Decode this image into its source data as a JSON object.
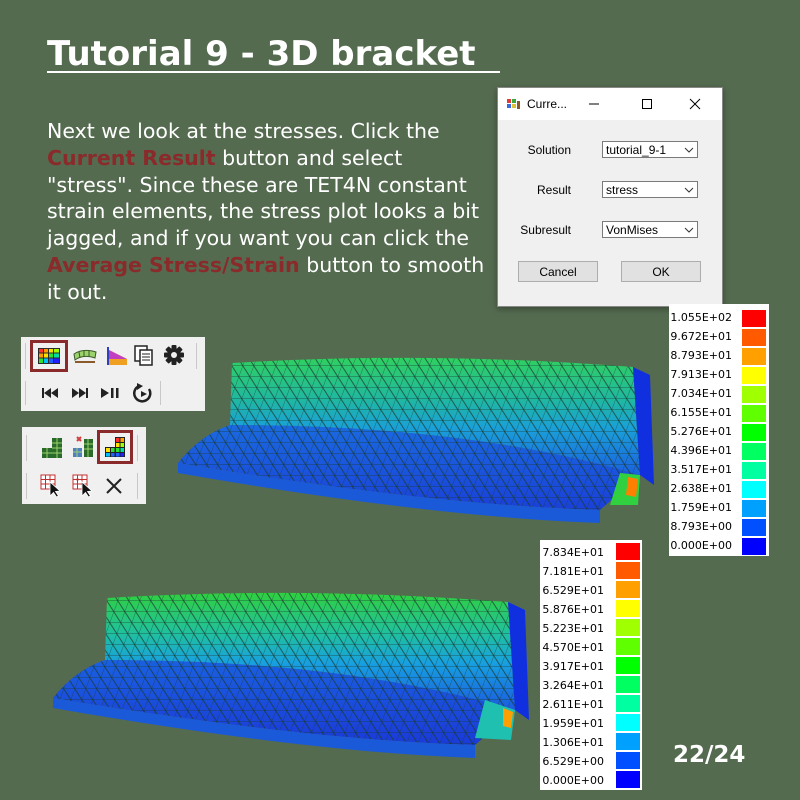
{
  "slide": {
    "title": "Tutorial 9 - 3D bracket ",
    "intro_parts": [
      "Next we look at the stresses. Click the ",
      "Current Result",
      " button and select \"stress\". Since these are TET4N constant strain elements, the stress plot looks a bit jagged, and if you want you can click the ",
      "Average Stress/Strain",
      " button to smooth it out."
    ],
    "page_number": "22/24",
    "highlight_color": "#8a2a2a",
    "background_color": "#556b50"
  },
  "dialog": {
    "title": "Curre...",
    "rows": [
      {
        "label": "Solution",
        "value": "tutorial_9-1"
      },
      {
        "label": "Result",
        "value": "stress"
      },
      {
        "label": "Subresult",
        "value": "VonMises"
      }
    ],
    "cancel_label": "Cancel",
    "ok_label": "OK"
  },
  "toolbar1": {
    "row1_icons": [
      "current-result-icon",
      "deformed-mesh-icon",
      "contour-plot-icon",
      "copy-icon",
      "settings-gear-icon"
    ],
    "row2_icons": [
      "skip-to-start-icon",
      "fast-forward-icon",
      "play-pause-icon",
      "animation-cycle-icon"
    ],
    "highlighted_icon": "current-result-icon"
  },
  "toolbar2": {
    "row1_icons": [
      "mesh-grid-icon",
      "split-mesh-icon",
      "average-stress-strain-icon"
    ],
    "row2_icons": [
      "select-elements-icon",
      "select-nodes-icon",
      "clear-selection-icon"
    ],
    "highlighted_icon": "average-stress-strain-icon"
  },
  "legend_top": {
    "labels": [
      "1.055E+02",
      "9.672E+01",
      "8.793E+01",
      "7.913E+01",
      "7.034E+01",
      "6.155E+01",
      "5.276E+01",
      "4.396E+01",
      "3.517E+01",
      "2.638E+01",
      "1.759E+01",
      "8.793E+00",
      "0.000E+00"
    ]
  },
  "legend_bottom": {
    "labels": [
      "7.834E+01",
      "7.181E+01",
      "6.529E+01",
      "5.876E+01",
      "5.223E+01",
      "4.570E+01",
      "3.917E+01",
      "3.264E+01",
      "2.611E+01",
      "1.959E+01",
      "1.306E+01",
      "6.529E+00",
      "0.000E+00"
    ]
  },
  "legend_colors": [
    "#ff0000",
    "#ff5a00",
    "#ffa000",
    "#ffff00",
    "#a0ff00",
    "#60ff00",
    "#00ff00",
    "#00ff60",
    "#00ffa0",
    "#00ffff",
    "#00a0ff",
    "#0050ff",
    "#0000ff"
  ]
}
